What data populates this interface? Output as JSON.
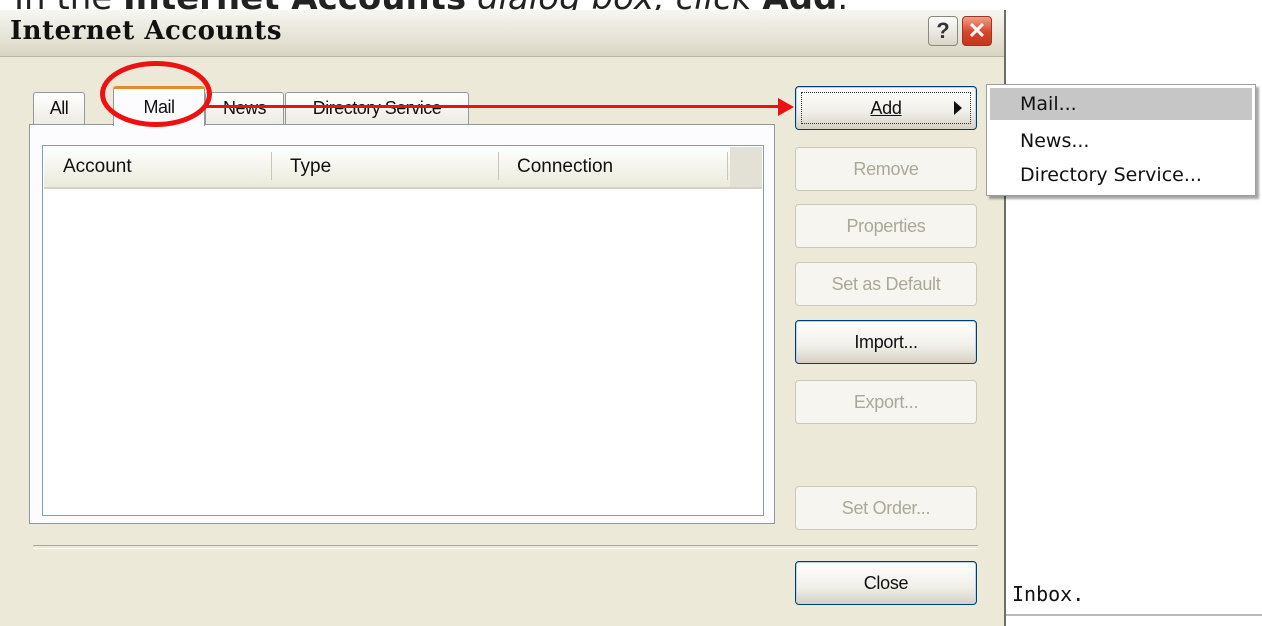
{
  "instruction": {
    "prefix": "In the ",
    "bold": "Internet Accounts",
    "middle": " dialog box, click ",
    "bold2": "Add",
    "suffix": "."
  },
  "dialog": {
    "title": "Internet Accounts",
    "help_label": "?",
    "close_label": "✕"
  },
  "tabs": [
    {
      "label": "All"
    },
    {
      "label": "Mail"
    },
    {
      "label": "News"
    },
    {
      "label": "Directory Service"
    }
  ],
  "list": {
    "columns": [
      "Account",
      "Type",
      "Connection"
    ]
  },
  "buttons": {
    "add": "Add",
    "remove": "Remove",
    "properties": "Properties",
    "set_default": "Set as Default",
    "import": "Import...",
    "export": "Export...",
    "set_order": "Set Order...",
    "close": "Close"
  },
  "menu": {
    "items": [
      "Mail...",
      "News...",
      "Directory Service..."
    ]
  },
  "background": {
    "inbox_text": "Inbox."
  },
  "colors": {
    "annotation": "#ee1111",
    "selected_tab_accent": "#e68b2c",
    "dialog_bg": "#ece9d8"
  }
}
